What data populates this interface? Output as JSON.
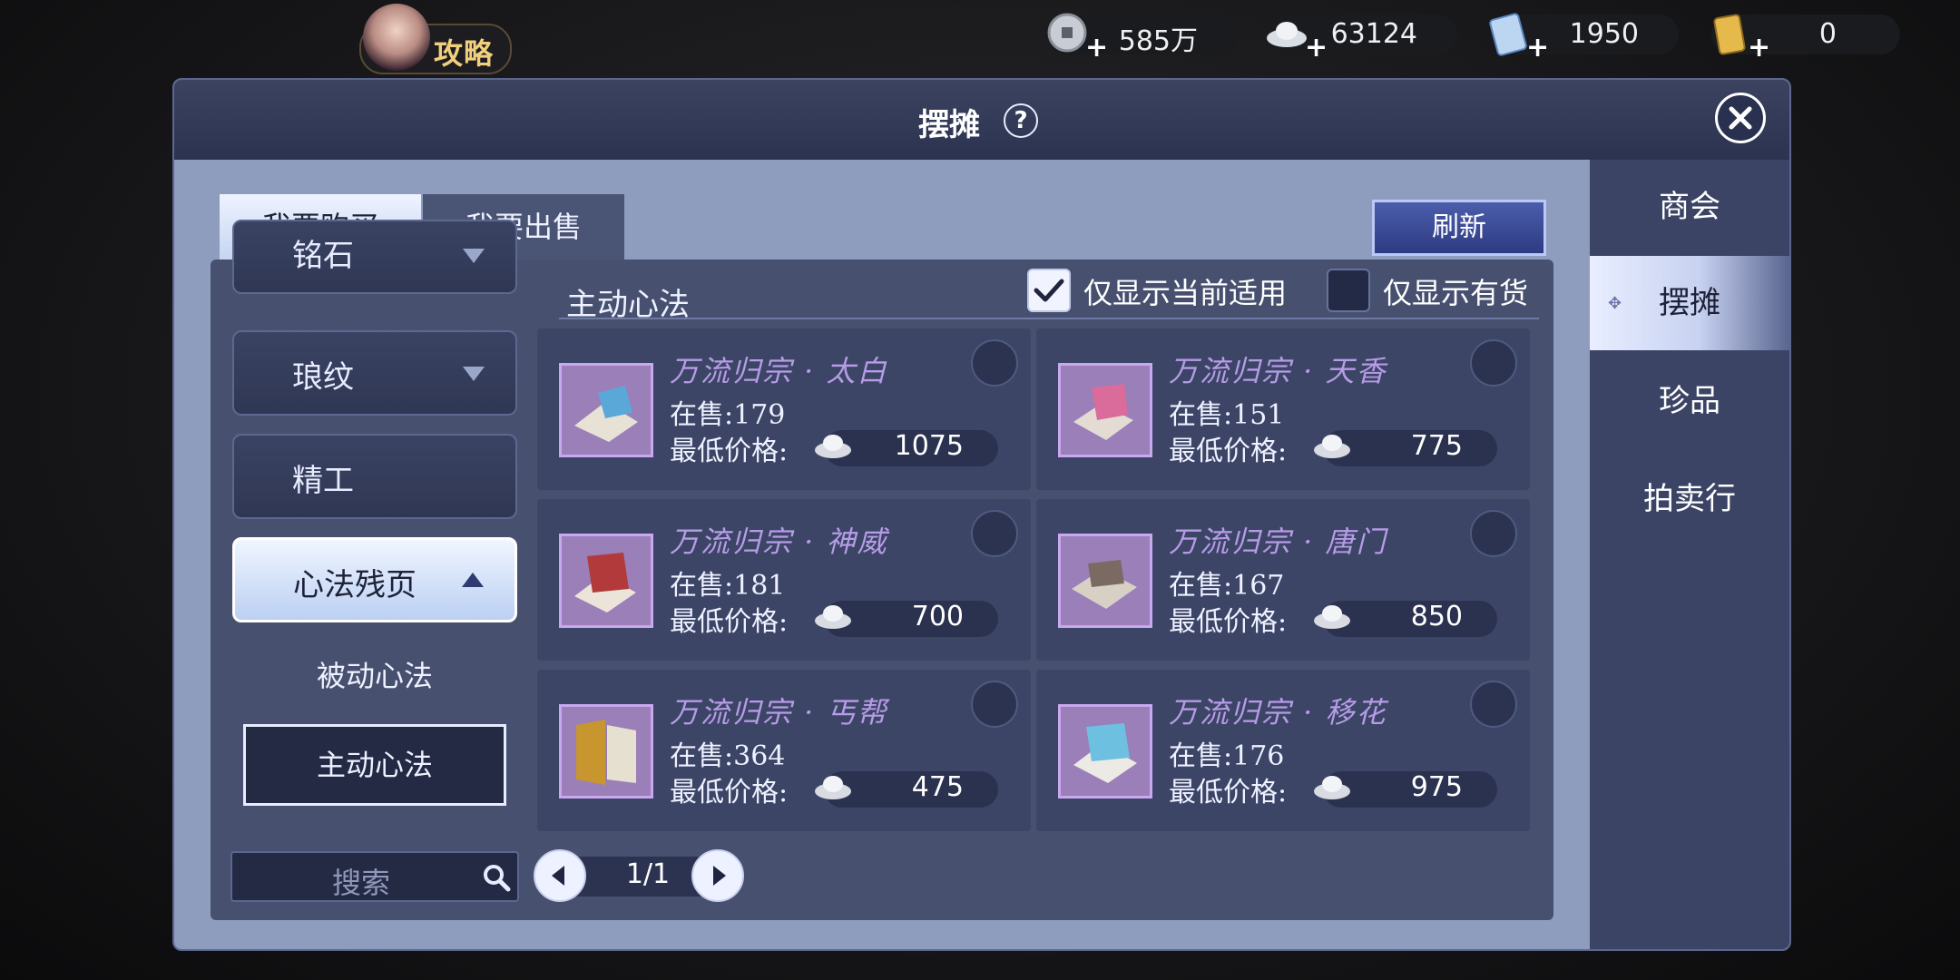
{
  "topbar": {
    "guide_label": "攻略",
    "currencies": [
      {
        "icon": "coin-icon",
        "value": "585万"
      },
      {
        "icon": "silver-ingot-icon",
        "value": "63124"
      },
      {
        "icon": "scroll-ticket-icon",
        "value": "1950"
      },
      {
        "icon": "gold-token-icon",
        "value": "0"
      }
    ]
  },
  "panel": {
    "title": "摆摊",
    "help": "?"
  },
  "nav": {
    "items": [
      {
        "label": "商会"
      },
      {
        "label": "摆摊"
      },
      {
        "label": "珍品"
      },
      {
        "label": "拍卖行"
      }
    ]
  },
  "tabs": {
    "buy": "我要购买",
    "sell": "我要出售"
  },
  "refresh_label": "刷新",
  "sidebar": {
    "partial_item": "铭石",
    "items": [
      {
        "label": "琅纹"
      },
      {
        "label": "精工"
      },
      {
        "label": "心法残页"
      }
    ],
    "sub_items": [
      {
        "label": "被动心法"
      },
      {
        "label": "主动心法"
      }
    ]
  },
  "list": {
    "title": "主动心法",
    "filter_current": "仅显示当前适用",
    "filter_stock": "仅显示有货",
    "price_label": "最低价格:",
    "stock_prefix": "在售:",
    "items": [
      {
        "name": "万流归宗 · 太白",
        "stock": "在售:179",
        "price": "1075"
      },
      {
        "name": "万流归宗 · 天香",
        "stock": "在售:151",
        "price": "775"
      },
      {
        "name": "万流归宗 · 神威",
        "stock": "在售:181",
        "price": "700"
      },
      {
        "name": "万流归宗 · 唐门",
        "stock": "在售:167",
        "price": "850"
      },
      {
        "name": "万流归宗 · 丐帮",
        "stock": "在售:364",
        "price": "475"
      },
      {
        "name": "万流归宗 · 移花",
        "stock": "在售:176",
        "price": "975"
      }
    ]
  },
  "search": {
    "placeholder": "搜索"
  },
  "pager": {
    "text": "1/1"
  }
}
